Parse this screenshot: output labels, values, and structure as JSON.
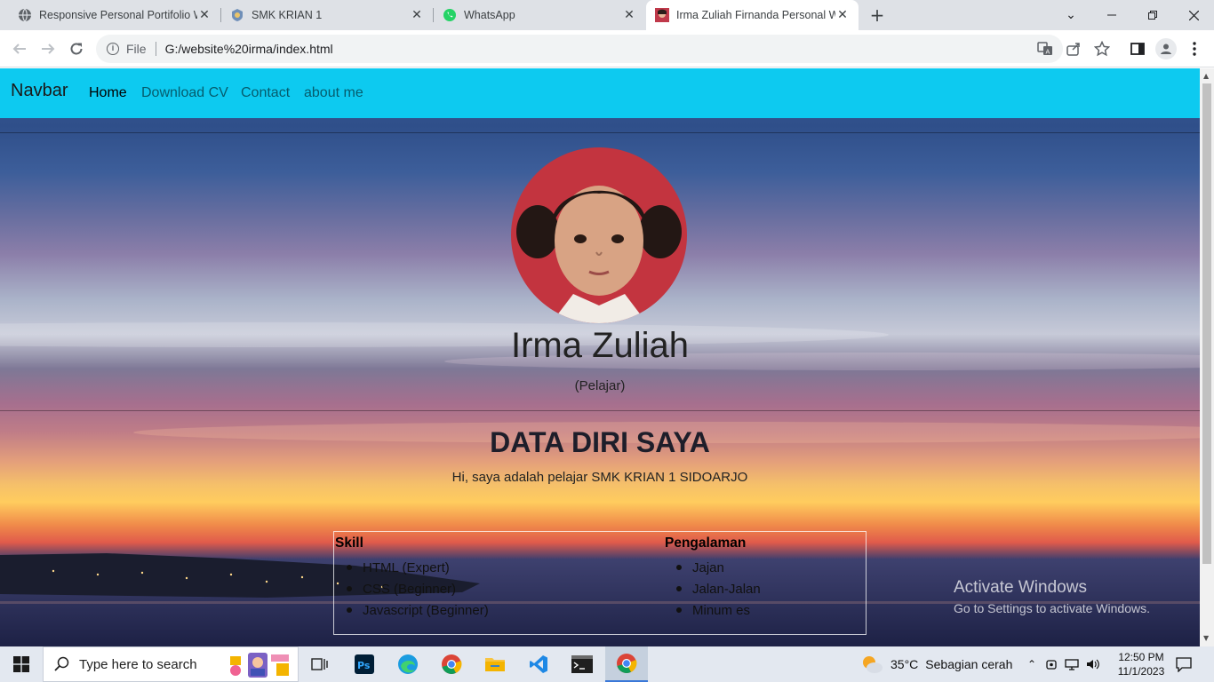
{
  "browser": {
    "tabs": [
      {
        "title": "Responsive Personal Portifolio W",
        "icon": "globe-icon"
      },
      {
        "title": "SMK KRIAN 1",
        "icon": "school-logo-icon"
      },
      {
        "title": "WhatsApp",
        "icon": "whatsapp-icon"
      },
      {
        "title": "Irma Zuliah Firnanda Personal W",
        "icon": "profile-favicon",
        "active": true
      }
    ],
    "address": {
      "scheme": "File",
      "url": "G:/website%20irma/index.html"
    }
  },
  "page": {
    "navbar": {
      "brand": "Navbar",
      "links": [
        {
          "label": "Home",
          "active": true
        },
        {
          "label": "Download CV"
        },
        {
          "label": "Contact"
        },
        {
          "label": "about me"
        }
      ],
      "color": "#0dcaf0"
    },
    "profile": {
      "name": "Irma Zuliah",
      "role": "(Pelajar)"
    },
    "about": {
      "title": "DATA DIRI SAYA",
      "subtitle": "Hi, saya adalah pelajar SMK KRIAN 1 SIDOARJO"
    },
    "table": {
      "skill": {
        "heading": "Skill",
        "items": [
          "HTML (Expert)",
          "CSS (Beginner)",
          "Javascript (Beginner)"
        ]
      },
      "experience": {
        "heading": "Pengalaman",
        "items": [
          "Jajan",
          "Jalan-Jalan",
          "Minum es"
        ]
      }
    }
  },
  "watermark": {
    "line1": "Activate Windows",
    "line2": "Go to Settings to activate Windows."
  },
  "taskbar": {
    "search_placeholder": "Type here to search",
    "weather": {
      "temp": "35°C",
      "desc": "Sebagian cerah"
    },
    "time": "12:50 PM",
    "date": "11/1/2023"
  }
}
